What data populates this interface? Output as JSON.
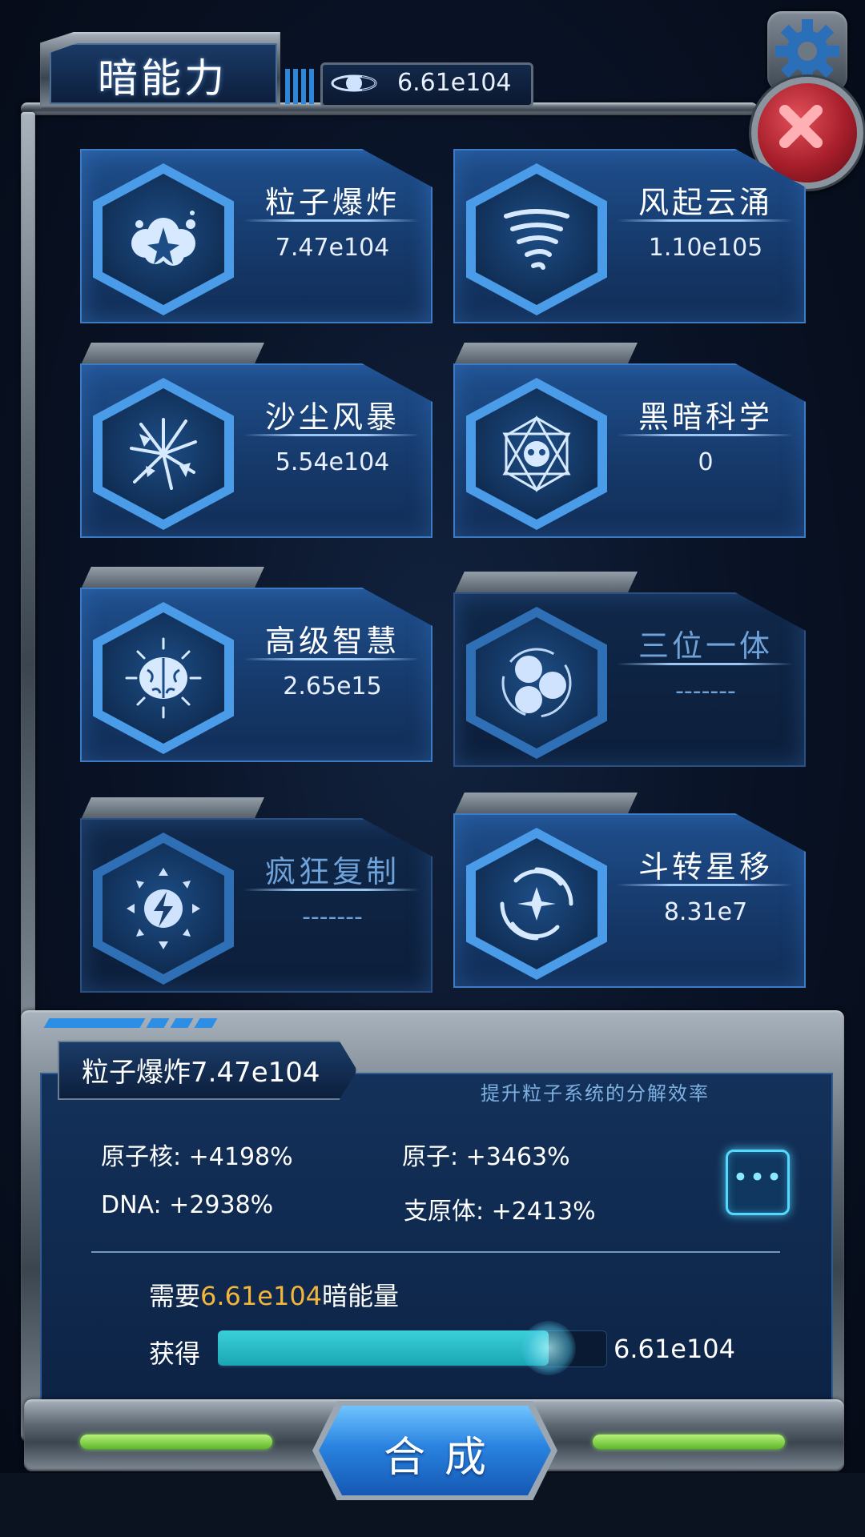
{
  "header": {
    "title": "暗能力",
    "energy_value": "6.61e104"
  },
  "skills": [
    {
      "name": "粒子爆炸",
      "value": "7.47e104",
      "icon": "particle-explosion-icon",
      "state": "active"
    },
    {
      "name": "风起云涌",
      "value": "1.10e105",
      "icon": "tornado-icon",
      "state": "active"
    },
    {
      "name": "沙尘风暴",
      "value": "5.54e104",
      "icon": "sandstorm-icon",
      "state": "active"
    },
    {
      "name": "黑暗科学",
      "value": "0",
      "icon": "hexagram-icon",
      "state": "active"
    },
    {
      "name": "高级智慧",
      "value": "2.65e15",
      "icon": "brain-icon",
      "state": "active"
    },
    {
      "name": "三位一体",
      "value": "-------",
      "icon": "trinity-icon",
      "state": "locked"
    },
    {
      "name": "疯狂复制",
      "value": "-------",
      "icon": "lightning-replicate-icon",
      "state": "locked"
    },
    {
      "name": "斗转星移",
      "value": "8.31e7",
      "icon": "star-vortex-icon",
      "state": "active"
    }
  ],
  "detail": {
    "title": "粒子爆炸7.47e104",
    "description": "提升粒子系统的分解效率",
    "stats": [
      {
        "text": "原子核: +4198%"
      },
      {
        "text": "原子: +3463%"
      },
      {
        "text": "DNA: +2938%"
      },
      {
        "text": "支原体: +2413%"
      }
    ],
    "more_label": "•••",
    "need_prefix": "需要",
    "need_value": "6.61e104",
    "need_suffix": "暗能量",
    "get_label": "获得",
    "get_value": "6.61e104",
    "slider_fraction": 0.85
  },
  "synth_button_label": "合成",
  "colors": {
    "accent": "#2f86d6",
    "highlight": "#f4b63a",
    "close": "#c0303c",
    "slider": "#2bbcc8"
  }
}
